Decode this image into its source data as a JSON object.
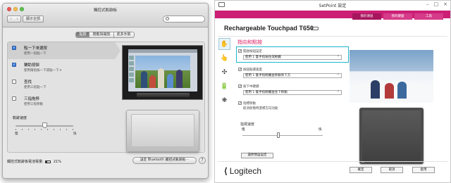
{
  "mac": {
    "window_title": "觸控式軌跡板",
    "back_icon": "‹",
    "forward_icon": "›",
    "show_all": "顯示全部",
    "search_placeholder": "",
    "tabs": [
      {
        "label": "點按",
        "active": true
      },
      {
        "label": "捲動與縮放",
        "active": false
      },
      {
        "label": "更多手勢",
        "active": false
      }
    ],
    "options": [
      {
        "title": "點一下來選按",
        "subtitle": "使用一指點一下",
        "checked": true,
        "selected": true
      },
      {
        "title": "輔助按鈕",
        "subtitle": "使用兩指按一下或點一下 ▾",
        "checked": true,
        "selected": false
      },
      {
        "title": "查找",
        "subtitle": "使用三指點一下",
        "checked": false,
        "selected": false
      },
      {
        "title": "三指拖移",
        "subtitle": "使用三指移動",
        "checked": false,
        "selected": false
      }
    ],
    "tracking_speed": {
      "label": "軌跡速度",
      "slow": "慢",
      "fast": "快",
      "value_fraction": 0.5
    },
    "battery_label": "觸控式軌跡板電池電量:",
    "battery_value": "21%",
    "bluetooth_button": "設定 Bluetooth 觸控式軌跡板⋯",
    "help_button": "?"
  },
  "setpoint": {
    "window_title": "SetPoint 設定",
    "window_controls": [
      "–",
      "□",
      "×"
    ],
    "nav_tabs": [
      {
        "label": "我的滑鼠",
        "active": true
      },
      {
        "label": "我的鍵盤",
        "active": false
      },
      {
        "label": "工具",
        "active": false
      }
    ],
    "device_name": "Rechargeable Touchpad T650",
    "device_chevron": "⌄",
    "side_tabs": [
      {
        "icon": "✋",
        "name": "gesture-tab-icon",
        "active": true
      },
      {
        "icon": "👆",
        "name": "pointer-tab-icon",
        "active": false
      },
      {
        "icon": "✣",
        "name": "scroll-tab-icon",
        "active": false
      },
      {
        "icon": "🔋",
        "name": "battery-tab-icon",
        "active": false
      },
      {
        "icon": "❋",
        "name": "settings-tab-icon",
        "active": false
      }
    ],
    "section_title": "指向和點按",
    "groups": [
      {
        "label": "開啟按鈕設定",
        "checked": true,
        "select": "使用 1 隻手指按住或輕觸",
        "highlighted": true
      },
      {
        "label": "按鈕點選速度",
        "checked": true,
        "select": "使用 1 隻手指輕觸並移動到下方",
        "highlighted": false
      },
      {
        "label": "按下中鍵鍵",
        "checked": true,
        "select": "使用 1 隻手指輕觸並往下移動",
        "highlighted": false
      },
      {
        "label": "指標移動",
        "checked": true,
        "subtitle": "取消狀態時游標方向功能",
        "highlighted": false
      }
    ],
    "speed": {
      "label": "指標速度",
      "slow": "慢",
      "fast": "快",
      "value_fraction": 0.45
    },
    "default_button": "還原預設設定",
    "brand": "Logitech",
    "brand_mark": "⟨",
    "footer_buttons": [
      "確定",
      "取消",
      "套用"
    ],
    "accent_color": "#cc1e75"
  }
}
